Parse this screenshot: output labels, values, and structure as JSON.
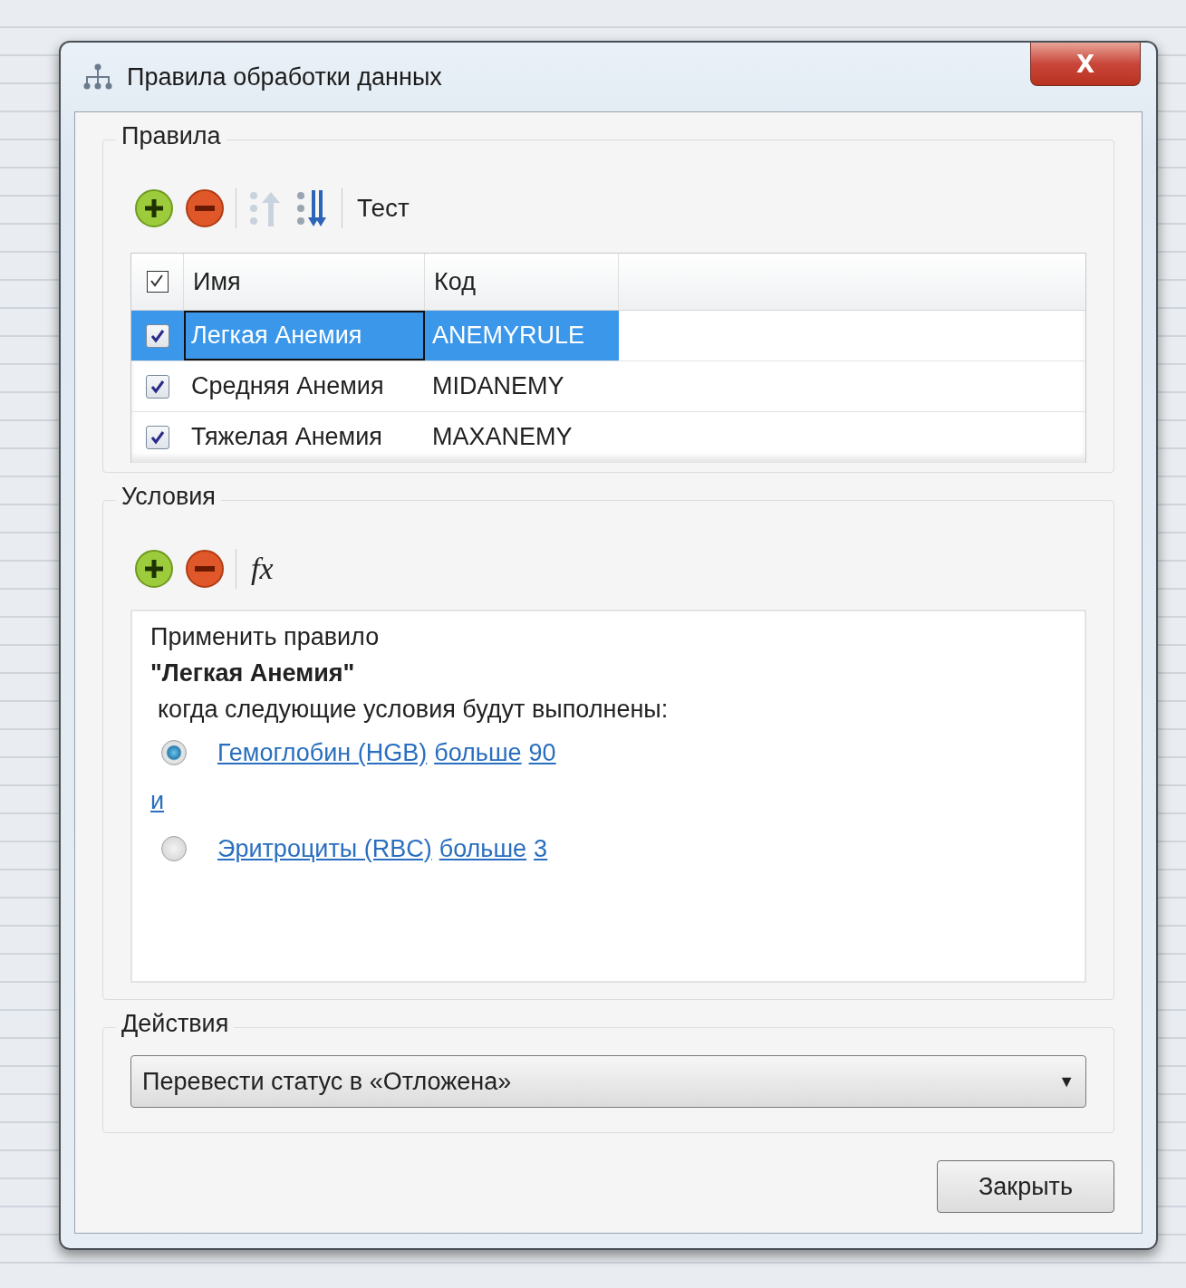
{
  "window": {
    "title": "Правила обработки данных",
    "close_label": "X"
  },
  "rules": {
    "title": "Правила",
    "toolbar": {
      "test_label": "Тест"
    },
    "columns": [
      "Имя",
      "Код"
    ],
    "header_checked": true,
    "rows": [
      {
        "name": "Легкая Анемия",
        "code": "ANEMYRULE",
        "checked": true,
        "selected": true
      },
      {
        "name": "Средняя Анемия",
        "code": "MIDANEMY",
        "checked": true,
        "selected": false
      },
      {
        "name": "Тяжелая Анемия",
        "code": "MAXANEMY",
        "checked": true,
        "selected": false
      }
    ]
  },
  "conditions": {
    "title": "Условия",
    "toolbar": {
      "formula_label": "fx"
    },
    "intro": "Применить правило",
    "rule_name": "\"Легкая Анемия\"",
    "when_text": "когда следующие условия будут выполнены:",
    "items": [
      {
        "kind": "condition",
        "selected": true,
        "field": "Гемоглобин (HGB)",
        "operator": "больше",
        "value": "90"
      },
      {
        "kind": "connector",
        "text": "и"
      },
      {
        "kind": "condition",
        "selected": false,
        "field": "Эритроциты (RBC)",
        "operator": "больше",
        "value": "3"
      }
    ]
  },
  "actions": {
    "title": "Действия",
    "value": "Перевести статус в «Отложена»",
    "arrow": "▼"
  },
  "buttons": [
    "Закрыть"
  ]
}
